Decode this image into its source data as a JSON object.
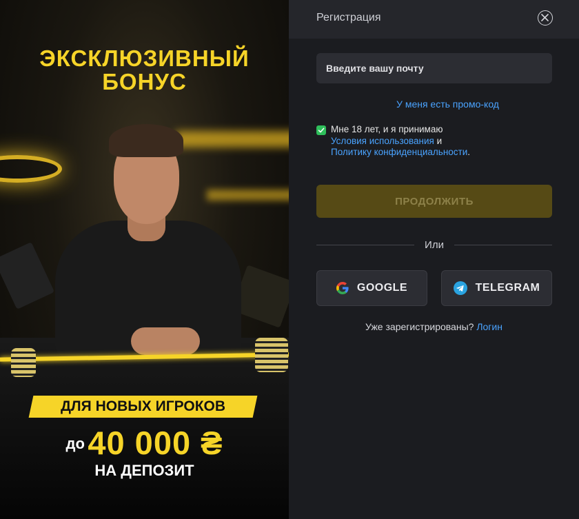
{
  "promo": {
    "title_line1": "ЭКСКЛЮЗИВНЫЙ",
    "title_line2": "БОНУС",
    "badge": "ДЛЯ НОВЫХ ИГРОКОВ",
    "amount_prefix": "до",
    "amount": "40 000 ₴",
    "deposit": "НА ДЕПОЗИТ",
    "accent_color": "#f6d428"
  },
  "modal": {
    "title": "Регистрация",
    "close_icon": "close-icon",
    "email_placeholder": "Введите вашу почту",
    "promo_code_link": "У меня есть промо-код",
    "agree": {
      "checked": true,
      "text_before": "Мне 18 лет, и я принимаю",
      "terms_link": "Условия использования",
      "and": " и",
      "privacy_link": "Политику конфиденциальности",
      "period": "."
    },
    "continue_button": "ПРОДОЛЖИТЬ",
    "or": "Или",
    "google_button": "GOOGLE",
    "telegram_button": "TELEGRAM",
    "already_registered": "Уже зарегистрированы?",
    "login_link": "Логин",
    "link_color": "#4aa3ff",
    "checkbox_color": "#2fbf5b"
  }
}
